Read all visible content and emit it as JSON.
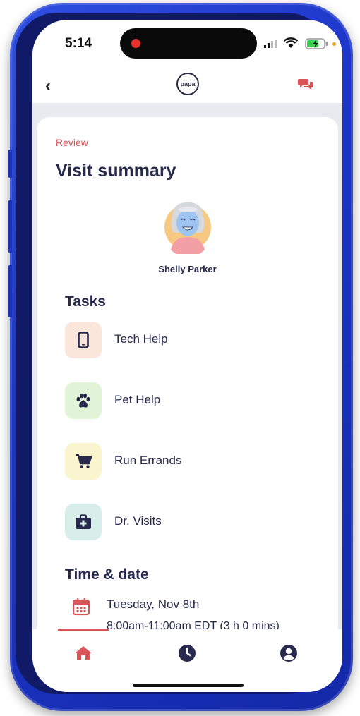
{
  "status_bar": {
    "time": "5:14"
  },
  "header": {
    "logo_text": "papa"
  },
  "summary": {
    "eyebrow": "Review",
    "title": "Visit summary",
    "member_name": "Shelly Parker"
  },
  "tasks": {
    "heading": "Tasks",
    "items": [
      {
        "label": "Tech Help",
        "icon": "phone-icon",
        "bg": "#fbe6dc"
      },
      {
        "label": "Pet Help",
        "icon": "paw-icon",
        "bg": "#e2f4d8"
      },
      {
        "label": "Run Errands",
        "icon": "cart-icon",
        "bg": "#fbf5cf"
      },
      {
        "label": "Dr. Visits",
        "icon": "medical-kit-icon",
        "bg": "#d8efe9"
      }
    ]
  },
  "time_date": {
    "heading": "Time & date",
    "date": "Tuesday, Nov 8th",
    "time_range": "8:00am-11:00am EDT (3 h 0 mins)"
  },
  "tab_bar": {
    "tabs": [
      "home-icon",
      "clock-icon",
      "user-icon"
    ],
    "active": "home-icon"
  },
  "colors": {
    "accent": "#d9555a",
    "text_dark": "#272a4c",
    "frame": "#1c35c7"
  }
}
